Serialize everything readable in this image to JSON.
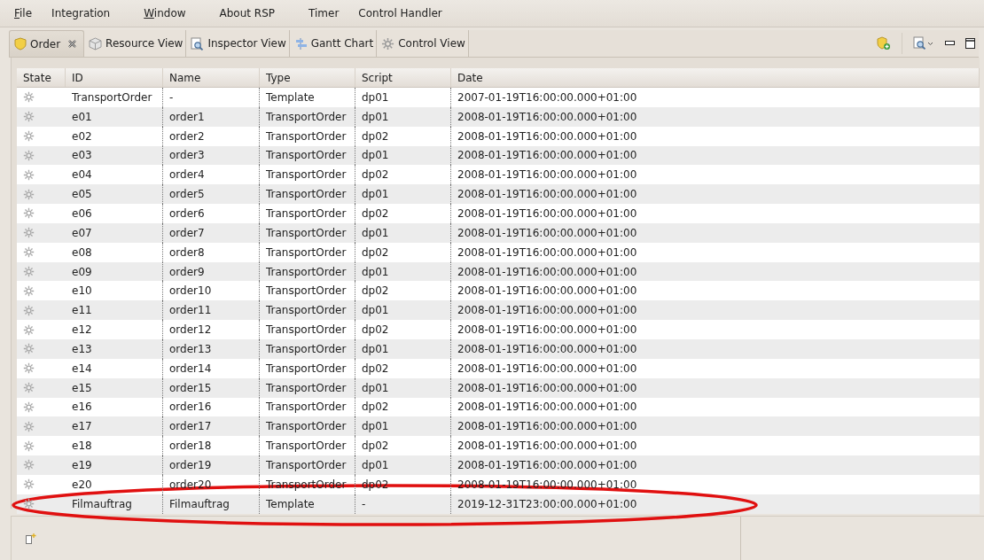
{
  "menu": [
    {
      "label": "File",
      "mnemonic": true
    },
    {
      "label": "Integration",
      "mnemonic": false
    },
    {
      "label": "Window",
      "mnemonic": true
    },
    {
      "label": "About RSP",
      "mnemonic": false
    },
    {
      "label": "Timer",
      "mnemonic": false
    },
    {
      "label": "Control Handler",
      "mnemonic": false
    }
  ],
  "tabs": [
    {
      "label": "Order",
      "selected": true,
      "closable": true
    },
    {
      "label": "Resource View",
      "selected": false,
      "closable": false
    },
    {
      "label": "Inspector View",
      "selected": false,
      "closable": false
    },
    {
      "label": "Gantt Chart",
      "selected": false,
      "closable": false
    },
    {
      "label": "Control View",
      "selected": false,
      "closable": false
    }
  ],
  "table": {
    "columns": [
      "State",
      "ID",
      "Name",
      "Type",
      "Script",
      "Date"
    ],
    "rows": [
      {
        "cells": [
          "",
          "TransportOrder",
          "-",
          "Template",
          "dp01",
          "2007-01-19T16:00:00.000+01:00"
        ]
      },
      {
        "cells": [
          "",
          "e01",
          "order1",
          "TransportOrder",
          "dp01",
          "2008-01-19T16:00:00.000+01:00"
        ]
      },
      {
        "cells": [
          "",
          "e02",
          "order2",
          "TransportOrder",
          "dp02",
          "2008-01-19T16:00:00.000+01:00"
        ]
      },
      {
        "cells": [
          "",
          "e03",
          "order3",
          "TransportOrder",
          "dp01",
          "2008-01-19T16:00:00.000+01:00"
        ]
      },
      {
        "cells": [
          "",
          "e04",
          "order4",
          "TransportOrder",
          "dp02",
          "2008-01-19T16:00:00.000+01:00"
        ]
      },
      {
        "cells": [
          "",
          "e05",
          "order5",
          "TransportOrder",
          "dp01",
          "2008-01-19T16:00:00.000+01:00"
        ]
      },
      {
        "cells": [
          "",
          "e06",
          "order6",
          "TransportOrder",
          "dp02",
          "2008-01-19T16:00:00.000+01:00"
        ]
      },
      {
        "cells": [
          "",
          "e07",
          "order7",
          "TransportOrder",
          "dp01",
          "2008-01-19T16:00:00.000+01:00"
        ]
      },
      {
        "cells": [
          "",
          "e08",
          "order8",
          "TransportOrder",
          "dp02",
          "2008-01-19T16:00:00.000+01:00"
        ]
      },
      {
        "cells": [
          "",
          "e09",
          "order9",
          "TransportOrder",
          "dp01",
          "2008-01-19T16:00:00.000+01:00"
        ]
      },
      {
        "cells": [
          "",
          "e10",
          "order10",
          "TransportOrder",
          "dp02",
          "2008-01-19T16:00:00.000+01:00"
        ]
      },
      {
        "cells": [
          "",
          "e11",
          "order11",
          "TransportOrder",
          "dp01",
          "2008-01-19T16:00:00.000+01:00"
        ]
      },
      {
        "cells": [
          "",
          "e12",
          "order12",
          "TransportOrder",
          "dp02",
          "2008-01-19T16:00:00.000+01:00"
        ]
      },
      {
        "cells": [
          "",
          "e13",
          "order13",
          "TransportOrder",
          "dp01",
          "2008-01-19T16:00:00.000+01:00"
        ]
      },
      {
        "cells": [
          "",
          "e14",
          "order14",
          "TransportOrder",
          "dp02",
          "2008-01-19T16:00:00.000+01:00"
        ]
      },
      {
        "cells": [
          "",
          "e15",
          "order15",
          "TransportOrder",
          "dp01",
          "2008-01-19T16:00:00.000+01:00"
        ]
      },
      {
        "cells": [
          "",
          "e16",
          "order16",
          "TransportOrder",
          "dp02",
          "2008-01-19T16:00:00.000+01:00"
        ]
      },
      {
        "cells": [
          "",
          "e17",
          "order17",
          "TransportOrder",
          "dp01",
          "2008-01-19T16:00:00.000+01:00"
        ]
      },
      {
        "cells": [
          "",
          "e18",
          "order18",
          "TransportOrder",
          "dp02",
          "2008-01-19T16:00:00.000+01:00"
        ]
      },
      {
        "cells": [
          "",
          "e19",
          "order19",
          "TransportOrder",
          "dp01",
          "2008-01-19T16:00:00.000+01:00"
        ]
      },
      {
        "cells": [
          "",
          "e20",
          "order20",
          "TransportOrder",
          "dp02",
          "2008-01-19T16:00:00.000+01:00"
        ]
      },
      {
        "cells": [
          "",
          "Filmauftrag",
          "Filmauftrag",
          "Template",
          "-",
          "2019-12-31T23:00:00.000+01:00"
        ]
      }
    ]
  }
}
